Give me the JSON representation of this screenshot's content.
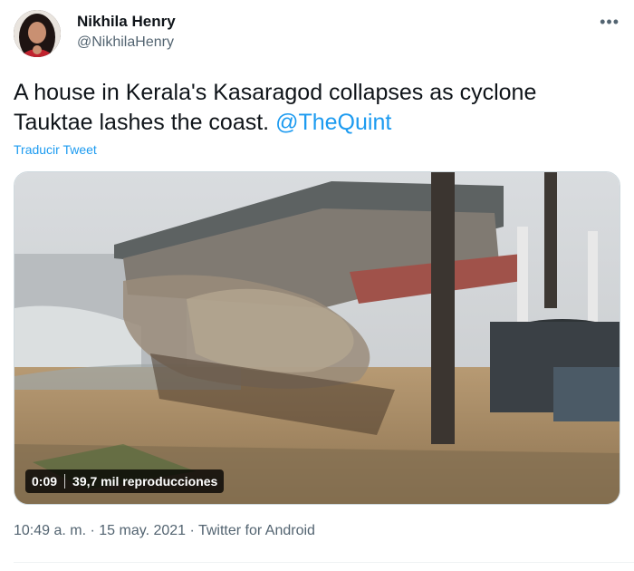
{
  "author": {
    "name": "Nikhila Henry",
    "handle": "@NikhilaHenry"
  },
  "tweet": {
    "text": "A house in Kerala's Kasaragod collapses as cyclone Tauktae lashes the coast.",
    "mention": "@TheQuint",
    "translate_label": "Traducir Tweet"
  },
  "video": {
    "duration": "0:09",
    "views": "39,7 mil reproducciones"
  },
  "meta": {
    "time": "10:49 a. m.",
    "date": "15 may. 2021",
    "source": "Twitter for Android",
    "separator": "·"
  },
  "icons": {
    "more": "more-options-icon"
  },
  "colors": {
    "link": "#1d9bf0",
    "secondary_text": "#536471"
  }
}
